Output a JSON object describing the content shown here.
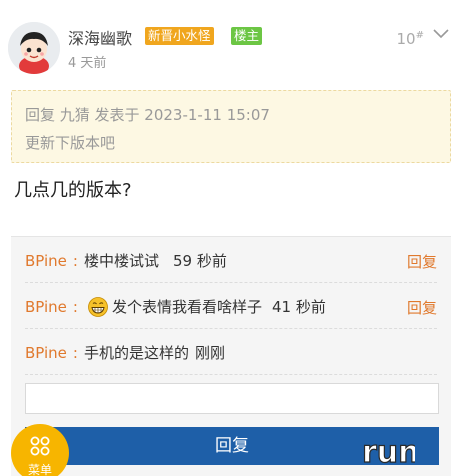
{
  "post": {
    "username": "深海幽歌",
    "level_badge": "新晋小水怪",
    "owner_badge": "楼主",
    "time": "4 天前",
    "floor_number": "10",
    "floor_mark": "#",
    "quote": {
      "header": "回复 九猜 发表于 2023-1-11 15:07",
      "body": "更新下版本吧"
    },
    "content": "几点几的版本?"
  },
  "comments": [
    {
      "author": "BPine",
      "separator": ":",
      "text": "楼中楼试试",
      "time": "59 秒前",
      "reply": "回复",
      "has_emoji": false,
      "emoji_name": ""
    },
    {
      "author": "BPine",
      "separator": ":",
      "text": "发个表情我看看啥样子",
      "time": "41 秒前",
      "reply": "回复",
      "has_emoji": true,
      "emoji_name": "grin-emoji"
    },
    {
      "author": "BPine",
      "separator": ":",
      "text": "手机的是这样的",
      "time": "刚刚",
      "reply": "",
      "has_emoji": false,
      "emoji_name": ""
    }
  ],
  "reply_box": {
    "value": "",
    "placeholder": "",
    "button_label": "回复"
  },
  "menu": {
    "label": "菜单",
    "icon": "grid-icon"
  },
  "logo_text": "run",
  "colors": {
    "accent_orange": "#e0792d",
    "level_badge": "#f0a61e",
    "owner_badge": "#6cc644",
    "quote_bg": "#fdf8e3",
    "reply_button": "#1e5fa8",
    "menu_fab": "#f7b500"
  }
}
